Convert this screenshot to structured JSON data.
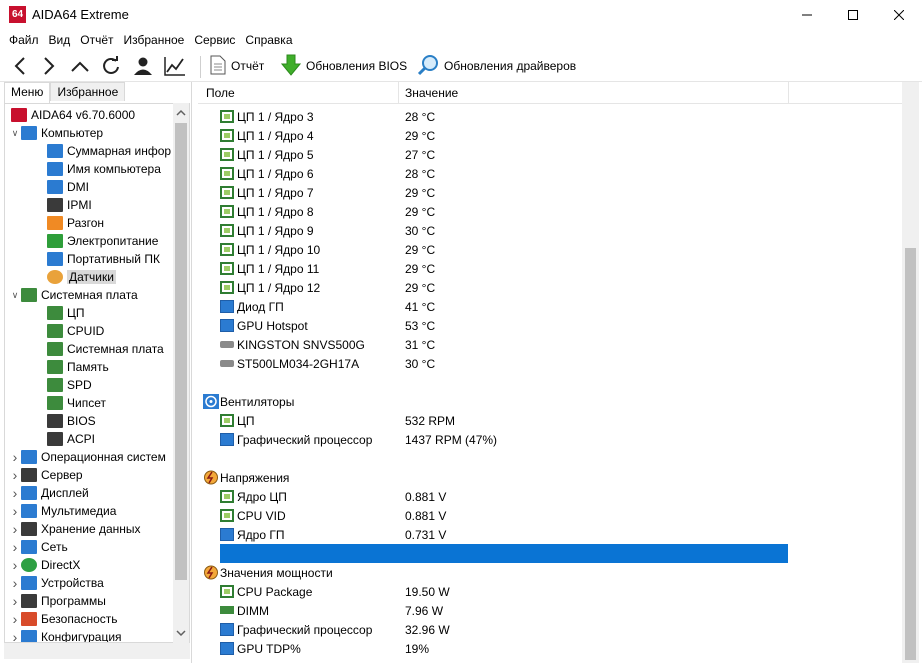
{
  "window": {
    "icon_text": "64",
    "title": "AIDA64 Extreme"
  },
  "menu": [
    "Файл",
    "Вид",
    "Отчёт",
    "Избранное",
    "Сервис",
    "Справка"
  ],
  "toolbar": {
    "report_label": "Отчёт",
    "bios_update_label": "Обновления BIOS",
    "driver_update_label": "Обновления драйверов"
  },
  "tabs": {
    "menu": "Меню",
    "favorites": "Избранное"
  },
  "tree": [
    {
      "label": "AIDA64 v6.70.6000",
      "icon": "aida-logo-icon",
      "indent": 0,
      "expander": ""
    },
    {
      "label": "Компьютер",
      "icon": "computer-icon",
      "indent": 0,
      "expander": "open"
    },
    {
      "label": "Суммарная инфор",
      "icon": "summary-monitor-icon",
      "indent": 1,
      "expander": ""
    },
    {
      "label": "Имя компьютера",
      "icon": "computer-name-icon",
      "indent": 1,
      "expander": ""
    },
    {
      "label": "DMI",
      "icon": "dmi-icon",
      "indent": 1,
      "expander": ""
    },
    {
      "label": "IPMI",
      "icon": "ipmi-icon",
      "indent": 1,
      "expander": ""
    },
    {
      "label": "Разгон",
      "icon": "flame-icon",
      "indent": 1,
      "expander": ""
    },
    {
      "label": "Электропитание",
      "icon": "power-plug-icon",
      "indent": 1,
      "expander": ""
    },
    {
      "label": "Портативный ПК",
      "icon": "laptop-icon",
      "indent": 1,
      "expander": ""
    },
    {
      "label": "Датчики",
      "icon": "gauge-icon",
      "indent": 1,
      "expander": "",
      "selected": true
    },
    {
      "label": "Системная плата",
      "icon": "motherboard-icon",
      "indent": 0,
      "expander": "open"
    },
    {
      "label": "ЦП",
      "icon": "cpu-icon",
      "indent": 1,
      "expander": ""
    },
    {
      "label": "CPUID",
      "icon": "cpuid-icon",
      "indent": 1,
      "expander": ""
    },
    {
      "label": "Системная плата",
      "icon": "board-icon",
      "indent": 1,
      "expander": ""
    },
    {
      "label": "Память",
      "icon": "memory-icon",
      "indent": 1,
      "expander": ""
    },
    {
      "label": "SPD",
      "icon": "spd-icon",
      "indent": 1,
      "expander": ""
    },
    {
      "label": "Чипсет",
      "icon": "chipset-icon",
      "indent": 1,
      "expander": ""
    },
    {
      "label": "BIOS",
      "icon": "bios-icon",
      "indent": 1,
      "expander": ""
    },
    {
      "label": "ACPI",
      "icon": "acpi-icon",
      "indent": 1,
      "expander": ""
    },
    {
      "label": "Операционная систем",
      "icon": "windows-icon",
      "indent": 0,
      "expander": "closed"
    },
    {
      "label": "Сервер",
      "icon": "server-icon",
      "indent": 0,
      "expander": "closed"
    },
    {
      "label": "Дисплей",
      "icon": "display-icon",
      "indent": 0,
      "expander": "closed"
    },
    {
      "label": "Мультимедиа",
      "icon": "multimedia-icon",
      "indent": 0,
      "expander": "closed"
    },
    {
      "label": "Хранение данных",
      "icon": "storage-icon",
      "indent": 0,
      "expander": "closed"
    },
    {
      "label": "Сеть",
      "icon": "network-icon",
      "indent": 0,
      "expander": "closed"
    },
    {
      "label": "DirectX",
      "icon": "xbox-icon",
      "indent": 0,
      "expander": "closed"
    },
    {
      "label": "Устройства",
      "icon": "devices-icon",
      "indent": 0,
      "expander": "closed"
    },
    {
      "label": "Программы",
      "icon": "programs-icon",
      "indent": 0,
      "expander": "closed"
    },
    {
      "label": "Безопасность",
      "icon": "shield-icon",
      "indent": 0,
      "expander": "closed"
    },
    {
      "label": "Конфигурация",
      "icon": "config-icon",
      "indent": 0,
      "expander": "closed"
    }
  ],
  "columns": {
    "field": "Поле",
    "value": "Значение"
  },
  "rows": [
    {
      "field": "ЦП 1 / Ядро 3",
      "value": "28 °C",
      "icon": "chip"
    },
    {
      "field": "ЦП 1 / Ядро 4",
      "value": "29 °C",
      "icon": "chip"
    },
    {
      "field": "ЦП 1 / Ядро 5",
      "value": "27 °C",
      "icon": "chip"
    },
    {
      "field": "ЦП 1 / Ядро 6",
      "value": "28 °C",
      "icon": "chip"
    },
    {
      "field": "ЦП 1 / Ядро 7",
      "value": "29 °C",
      "icon": "chip"
    },
    {
      "field": "ЦП 1 / Ядро 8",
      "value": "29 °C",
      "icon": "chip"
    },
    {
      "field": "ЦП 1 / Ядро 9",
      "value": "30 °C",
      "icon": "chip"
    },
    {
      "field": "ЦП 1 / Ядро 10",
      "value": "29 °C",
      "icon": "chip"
    },
    {
      "field": "ЦП 1 / Ядро 11",
      "value": "29 °C",
      "icon": "chip"
    },
    {
      "field": "ЦП 1 / Ядро 12",
      "value": "29 °C",
      "icon": "chip"
    },
    {
      "field": "Диод ГП",
      "value": "41 °C",
      "icon": "mon"
    },
    {
      "field": "GPU Hotspot",
      "value": "53 °C",
      "icon": "mon"
    },
    {
      "field": "KINGSTON SNVS500G",
      "value": "31 °C",
      "icon": "disk"
    },
    {
      "field": "ST500LM034-2GH17A",
      "value": "30 °C",
      "icon": "disk"
    },
    {
      "field": "",
      "value": "",
      "icon": ""
    },
    {
      "field": "Вентиляторы",
      "value": "",
      "icon": "fan",
      "group": true
    },
    {
      "field": "ЦП",
      "value": "532 RPM",
      "icon": "chip"
    },
    {
      "field": "Графический процессор",
      "value": "1437 RPM  (47%)",
      "icon": "mon"
    },
    {
      "field": "",
      "value": "",
      "icon": ""
    },
    {
      "field": "Напряжения",
      "value": "",
      "icon": "volt",
      "group": true
    },
    {
      "field": "Ядро ЦП",
      "value": "0.881 V",
      "icon": "chip"
    },
    {
      "field": "CPU VID",
      "value": "0.881 V",
      "icon": "chip"
    },
    {
      "field": "Ядро ГП",
      "value": "0.731 V",
      "icon": "mon"
    },
    {
      "field": "",
      "value": "",
      "icon": "",
      "highlight": true
    },
    {
      "field": "Значения мощности",
      "value": "",
      "icon": "volt",
      "group": true
    },
    {
      "field": "CPU Package",
      "value": "19.50 W",
      "icon": "chip"
    },
    {
      "field": "DIMM",
      "value": "7.96 W",
      "icon": "ram"
    },
    {
      "field": "Графический процессор",
      "value": "32.96 W",
      "icon": "mon"
    },
    {
      "field": "GPU TDP%",
      "value": "19%",
      "icon": "mon"
    }
  ],
  "colors": {
    "highlight": "#0a74d4",
    "app_icon": "#c8102e"
  }
}
